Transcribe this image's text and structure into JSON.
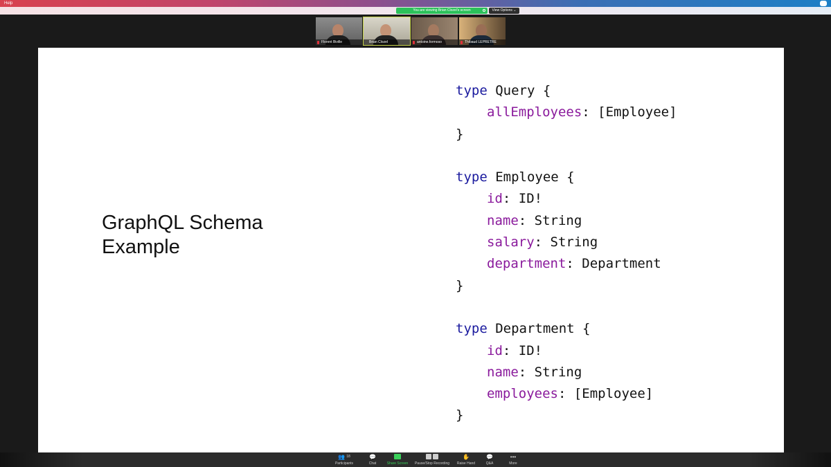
{
  "menubar": {
    "help_label": "Help"
  },
  "banner": {
    "viewing_text": "You are viewing Brian Clozel's screen",
    "view_options_label": "View Options ⌄"
  },
  "participants": [
    {
      "name": "Florent Biville"
    },
    {
      "name": "Brian Clozel"
    },
    {
      "name": "antoine.formoso"
    },
    {
      "name": "Thibaud LEPRETRE"
    }
  ],
  "slide": {
    "title_line1": "GraphQL Schema",
    "title_line2": "Example",
    "code": {
      "query_kw": "type",
      "query_name": " Query {",
      "query_field": "allEmployees",
      "query_field_type": ": [Employee]",
      "close": "}",
      "employee_kw": "type",
      "employee_name": " Employee {",
      "emp_id": "id",
      "emp_id_type": ": ID!",
      "emp_name": "name",
      "emp_name_type": ": String",
      "emp_salary": "salary",
      "emp_salary_type": ": String",
      "emp_dept": "department",
      "emp_dept_type": ": Department",
      "department_kw": "type",
      "department_name": " Department {",
      "dept_id": "id",
      "dept_id_type": ": ID!",
      "dept_name": "name",
      "dept_name_type": ": String",
      "dept_employees": "employees",
      "dept_employees_type": ": [Employee]"
    }
  },
  "toolbar": {
    "participants_label": "Participants",
    "participants_count": "18",
    "chat_label": "Chat",
    "share_label": "Share Screen",
    "record_label": "Pause/Stop Recording",
    "raise_label": "Raise Hand",
    "qa_label": "Q&A",
    "more_label": "More"
  },
  "colors": {
    "keyword": "#1a1a9e",
    "field": "#8a1a9c",
    "share_green": "#3ad05a"
  }
}
